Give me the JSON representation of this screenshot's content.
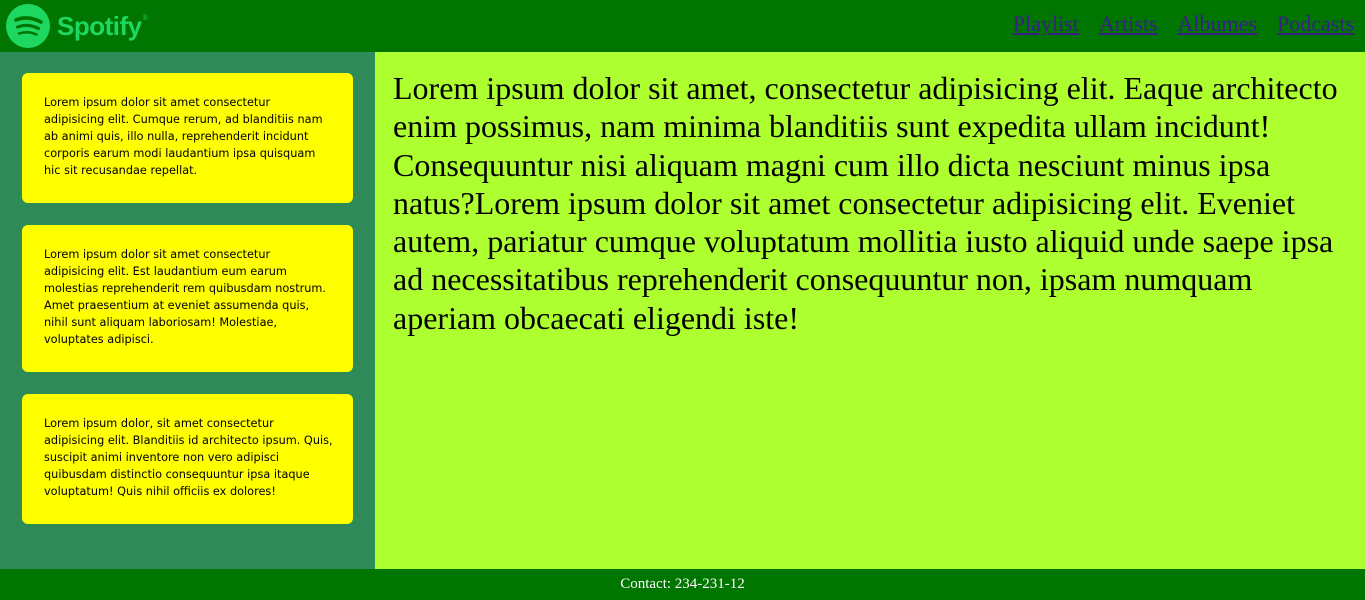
{
  "header": {
    "logo_text": "Spotify",
    "logo_tm": "®",
    "logo_icon": "spotify-logo-icon",
    "nav": [
      {
        "label": "Playlist"
      },
      {
        "label": "Artists"
      },
      {
        "label": "Albumes"
      },
      {
        "label": "Podcasts"
      }
    ]
  },
  "sidebar": {
    "cards": [
      {
        "text": "Lorem ipsum dolor sit amet consectetur adipisicing elit. Cumque rerum, ad blanditiis nam ab animi quis, illo nulla, reprehenderit incidunt corporis earum modi laudantium ipsa quisquam hic sit recusandae repellat."
      },
      {
        "text": "Lorem ipsum dolor sit amet consectetur adipisicing elit. Est laudantium eum earum molestias reprehenderit rem quibusdam nostrum. Amet praesentium at eveniet assumenda quis, nihil sunt aliquam laboriosam! Molestiae, voluptates adipisci."
      },
      {
        "text": "Lorem ipsum dolor, sit amet consectetur adipisicing elit. Blanditiis id architecto ipsum. Quis, suscipit animi inventore non vero adipisci quibusdam distinctio consequuntur ipsa itaque voluptatum! Quis nihil officiis ex dolores!"
      }
    ]
  },
  "main": {
    "text": "Lorem ipsum dolor sit amet, consectetur adipisicing elit. Eaque architecto enim possimus, nam minima blanditiis sunt expedita ullam incidunt! Consequuntur nisi aliquam magni cum illo dicta nesciunt minus ipsa natus?Lorem ipsum dolor sit amet consectetur adipisicing elit. Eveniet autem, pariatur cumque voluptatum mollitia iusto aliquid unde saepe ipsa ad necessitatibus reprehenderit consequuntur non, ipsam numquam aperiam obcaecati eligendi iste!"
  },
  "footer": {
    "contact": "Contact: 234-231-12"
  },
  "colors": {
    "header_bg": "#007500",
    "sidebar_bg": "#2e8b57",
    "card_bg": "#ffff00",
    "main_bg": "#adff2f",
    "logo_green": "#1ed760",
    "link": "#3a1e8a"
  }
}
